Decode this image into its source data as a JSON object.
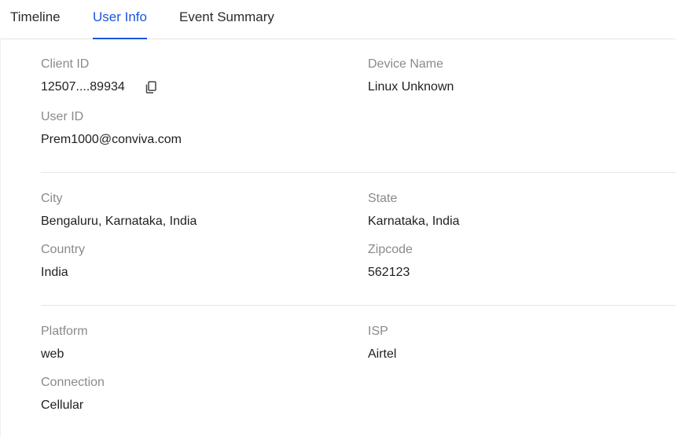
{
  "tabs": [
    {
      "label": "Timeline",
      "active": false
    },
    {
      "label": "User Info",
      "active": true
    },
    {
      "label": "Event Summary",
      "active": false
    }
  ],
  "colors": {
    "accent": "#1a56db",
    "label": "#8a8a8a",
    "value": "#1f1f1f",
    "divider": "#e6e6e6"
  },
  "sections": [
    {
      "fields": [
        {
          "label": "Client ID",
          "value": "12507....89934",
          "icon": "copy-icon"
        },
        {
          "label": "Device Name",
          "value": "Linux Unknown"
        },
        {
          "label": "User ID",
          "value": "Prem1000@conviva.com"
        }
      ]
    },
    {
      "fields": [
        {
          "label": "City",
          "value": "Bengaluru, Karnataka, India"
        },
        {
          "label": "State",
          "value": "Karnataka, India"
        },
        {
          "label": "Country",
          "value": "India"
        },
        {
          "label": "Zipcode",
          "value": "562123"
        }
      ]
    },
    {
      "fields": [
        {
          "label": "Platform",
          "value": "web"
        },
        {
          "label": "ISP",
          "value": "Airtel"
        },
        {
          "label": "Connection",
          "value": "Cellular"
        }
      ]
    }
  ]
}
